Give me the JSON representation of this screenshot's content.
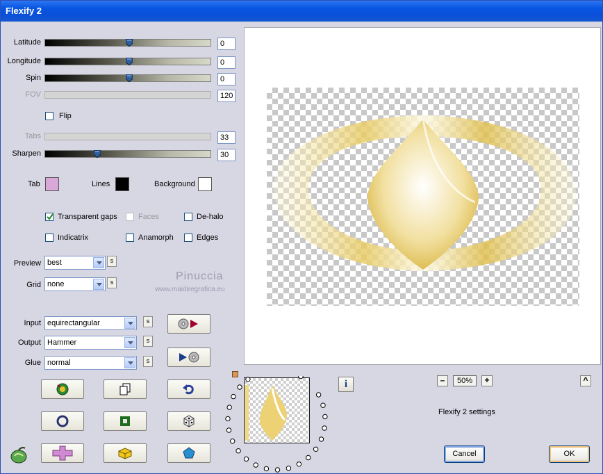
{
  "window": {
    "title": "Flexify 2"
  },
  "sliders": [
    {
      "key": "latitude",
      "label": "Latitude",
      "value": "0",
      "enabled": true,
      "pos": 0.5
    },
    {
      "key": "longitude",
      "label": "Longitude",
      "value": "0",
      "enabled": true,
      "pos": 0.5
    },
    {
      "key": "spin",
      "label": "Spin",
      "value": "0",
      "enabled": true,
      "pos": 0.5
    },
    {
      "key": "fov",
      "label": "FOV",
      "value": "120",
      "enabled": false,
      "pos": 0.5
    },
    {
      "key": "tabs",
      "label": "Tabs",
      "value": "33",
      "enabled": false,
      "pos": 0.33
    },
    {
      "key": "sharpen",
      "label": "Sharpen",
      "value": "30",
      "enabled": true,
      "pos": 0.3
    }
  ],
  "flip": {
    "label": "Flip",
    "checked": false
  },
  "colors": {
    "tab": {
      "label": "Tab",
      "color": "#d9a8d8"
    },
    "lines": {
      "label": "Lines",
      "color": "#000000"
    },
    "background": {
      "label": "Background",
      "color": "#ffffff"
    }
  },
  "options": {
    "transparent_gaps": {
      "label": "Transparent gaps",
      "checked": true
    },
    "faces": {
      "label": "Faces",
      "checked": false,
      "enabled": false
    },
    "de_halo": {
      "label": "De-halo",
      "checked": false
    },
    "indicatrix": {
      "label": "Indicatrix",
      "checked": false
    },
    "anamorph": {
      "label": "Anamorph",
      "checked": false
    },
    "edges": {
      "label": "Edges",
      "checked": false
    }
  },
  "preview_select": {
    "label": "Preview",
    "value": "best"
  },
  "grid_select": {
    "label": "Grid",
    "value": "none"
  },
  "input_select": {
    "label": "Input",
    "value": "equirectangular"
  },
  "output_select": {
    "label": "Output",
    "value": "Hammer"
  },
  "glue_select": {
    "label": "Glue",
    "value": "normal"
  },
  "s_label": "s",
  "watermark": {
    "name": "Pinuccia",
    "url": "www.maidiregrafica.eu"
  },
  "zoom": {
    "value": "50%",
    "minus": "–",
    "plus": "+",
    "up": "^"
  },
  "settings_name": "Flexify 2 settings",
  "buttons": {
    "cancel": "Cancel",
    "ok": "OK"
  },
  "accent": "#0a50d8"
}
